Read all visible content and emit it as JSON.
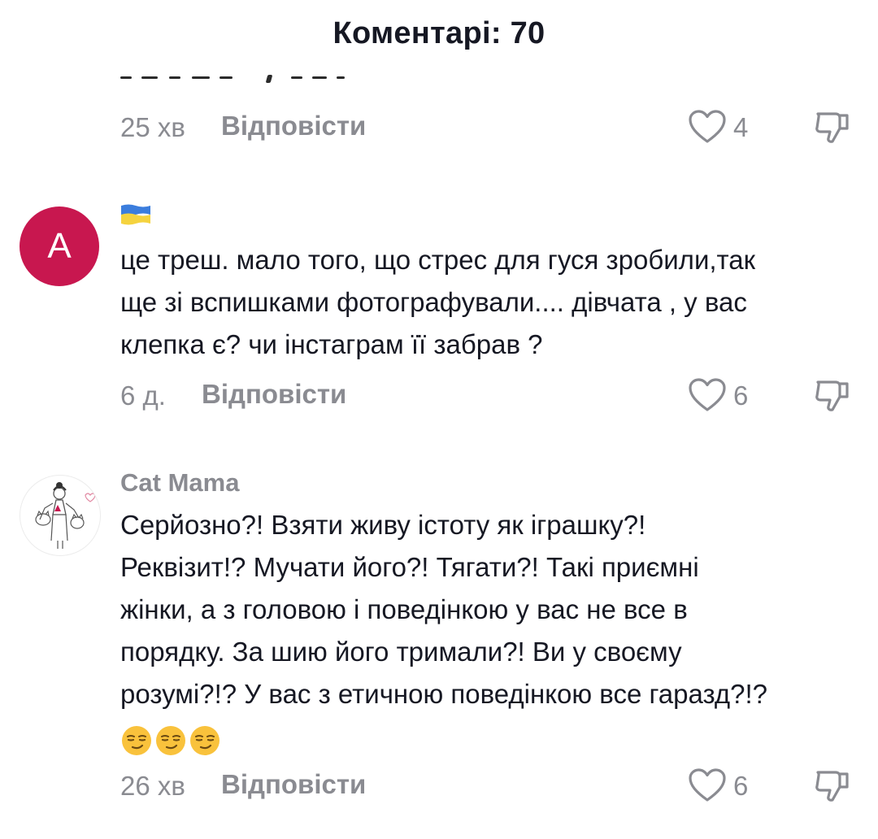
{
  "header": {
    "title": "Коментарі: 70"
  },
  "comments": [
    {
      "time": "25 хв",
      "reply_label": "Відповісти",
      "likes": "4",
      "icons": {
        "like": "heart-outline-icon",
        "dislike": "thumbs-down-icon"
      }
    },
    {
      "avatar_letter": "A",
      "avatar_color": "#c8174f",
      "flag": "ukraine-flag-icon",
      "text_lines": [
        "це треш. мало того, що стрес для гуся зробили,так",
        "ще зі вспишками фотографували.... дівчата , у вас",
        "клепка є? чи інстаграм її забрав ?"
      ],
      "time": "6 д.",
      "reply_label": "Відповісти",
      "likes": "6",
      "icons": {
        "like": "heart-outline-icon",
        "dislike": "thumbs-down-icon"
      }
    },
    {
      "username": "Cat Mama",
      "avatar": "cat-mama-avatar-drawing",
      "text_lines": [
        "Серйозно?! Взяти живу істоту як іграшку?!",
        "Реквізит!? Мучати його?! Тягати?! Такі приємні",
        "жінки, а з головою і поведінкою у вас не все в",
        "порядку. За шию його тримали?! Ви у своєму",
        "розумі?!? У вас з етичною поведінкою все гаразд?!?"
      ],
      "emojis": [
        "smirking-face-emoji",
        "smirking-face-emoji",
        "smirking-face-emoji"
      ],
      "time": "26 хв",
      "reply_label": "Відповісти",
      "likes": "6",
      "icons": {
        "like": "heart-outline-icon",
        "dislike": "thumbs-down-icon"
      }
    }
  ],
  "colors": {
    "text_primary": "#161823",
    "text_secondary": "#8a8b91",
    "avatar_a": "#c8174f",
    "flag_blue": "#3b7ddd",
    "flag_yellow": "#f5d33f",
    "emoji_yellow": "#f9c23c"
  }
}
